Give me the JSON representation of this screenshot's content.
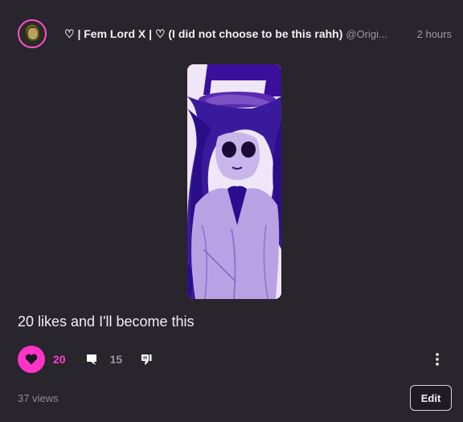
{
  "post": {
    "author_name": "♡ | Fem Lord X | ♡ (I did not choose to be this rahh)",
    "author_handle": "@Origi...",
    "timestamp": "2 hours",
    "text": "20 likes and I'll become this",
    "likes": "20",
    "comments": "15",
    "views": "37 views"
  },
  "actions": {
    "edit_label": "Edit"
  },
  "colors": {
    "background": "#28252d",
    "accent": "#ff34c7",
    "muted": "#9c97a6"
  },
  "icons": {
    "like": "heart-icon",
    "comment": "comment-bubble-icon",
    "dislike": "thumbs-down-icon",
    "more": "more-vertical-icon"
  }
}
